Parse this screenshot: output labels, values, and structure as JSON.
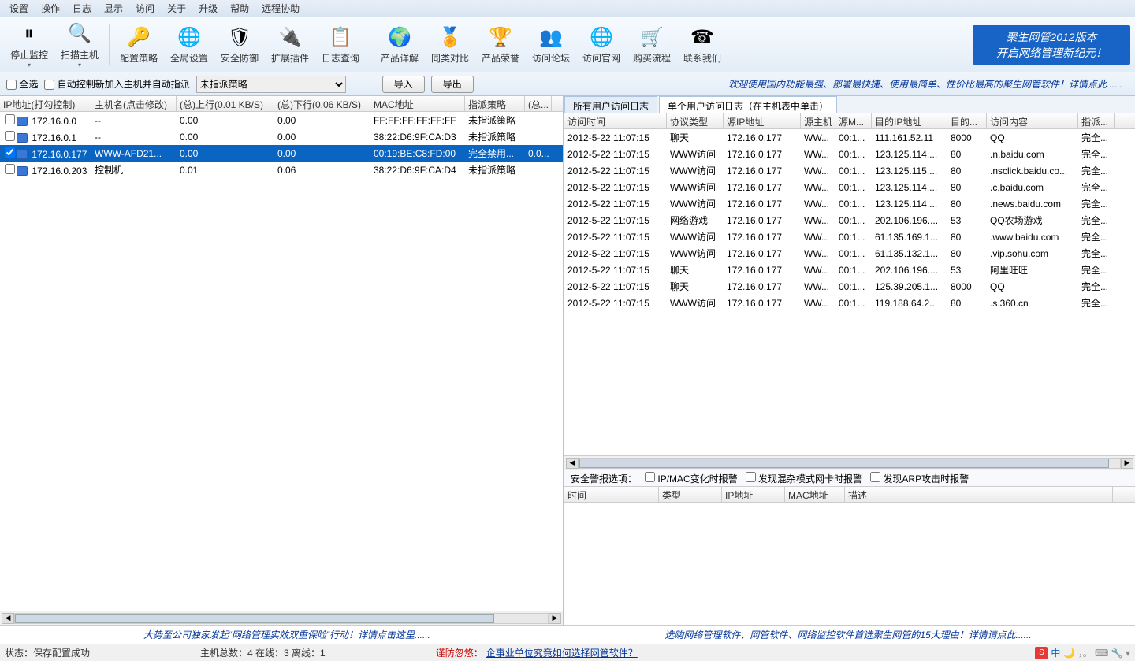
{
  "menu": [
    "设置",
    "操作",
    "日志",
    "显示",
    "访问",
    "关于",
    "升级",
    "帮助",
    "远程协助"
  ],
  "toolbar": {
    "items": [
      {
        "icon": "⏸",
        "label": "停止监控",
        "name": "stop-monitor-button",
        "split": true
      },
      {
        "icon": "🔍",
        "label": "扫描主机",
        "name": "scan-host-button",
        "split": true
      },
      {
        "sep": true
      },
      {
        "icon": "🔑",
        "label": "配置策略",
        "name": "config-policy-button"
      },
      {
        "icon": "🌐",
        "label": "全局设置",
        "name": "global-settings-button"
      },
      {
        "icon": "🛡",
        "label": "安全防御",
        "name": "security-defense-button"
      },
      {
        "icon": "🔌",
        "label": "扩展插件",
        "name": "plugins-button"
      },
      {
        "icon": "📋",
        "label": "日志查询",
        "name": "log-query-button"
      },
      {
        "sep": true
      },
      {
        "icon": "🌍",
        "label": "产品详解",
        "name": "product-detail-button"
      },
      {
        "icon": "🏅",
        "label": "同类对比",
        "name": "compare-button"
      },
      {
        "icon": "🏆",
        "label": "产品荣誉",
        "name": "honors-button"
      },
      {
        "icon": "👥",
        "label": "访问论坛",
        "name": "forum-button"
      },
      {
        "icon": "🌐",
        "label": "访问官网",
        "name": "website-button"
      },
      {
        "icon": "🛒",
        "label": "购买流程",
        "name": "purchase-button"
      },
      {
        "icon": "☎",
        "label": "联系我们",
        "name": "contact-button"
      }
    ]
  },
  "promo": {
    "line1": "聚生网管2012版本",
    "line2": "开启网络管理新纪元！"
  },
  "controlbar": {
    "select_all": "全选",
    "auto_control": "自动控制新加入主机并自动指派",
    "policy_dropdown": "未指派策略",
    "import": "导入",
    "export": "导出",
    "marquee": "欢迎使用国内功能最强、部署最快捷、使用最简单、性价比最高的聚生网管软件！详情点此......"
  },
  "hosts": {
    "columns": [
      "IP地址(打勾控制)",
      "主机名(点击修改)",
      "(总)上行(0.01 KB/S)",
      "(总)下行(0.06 KB/S)",
      "MAC地址",
      "指派策略",
      "(总..."
    ],
    "widths": [
      116,
      108,
      124,
      122,
      120,
      76,
      34
    ],
    "rows": [
      {
        "checked": false,
        "ip": "172.16.0.0",
        "host": "--",
        "up": "0.00",
        "down": "0.00",
        "mac": "FF:FF:FF:FF:FF:FF",
        "policy": "未指派策略",
        "selected": false
      },
      {
        "checked": false,
        "ip": "172.16.0.1",
        "host": "--",
        "up": "0.00",
        "down": "0.00",
        "mac": "38:22:D6:9F:CA:D3",
        "policy": "未指派策略",
        "selected": false
      },
      {
        "checked": true,
        "ip": "172.16.0.177",
        "host": "WWW-AFD21...",
        "up": "0.00",
        "down": "0.00",
        "mac": "00:19:BE:C8:FD:00",
        "policy": "完全禁用...",
        "extra": "0.0...",
        "selected": true
      },
      {
        "checked": false,
        "ip": "172.16.0.203",
        "host": "控制机",
        "up": "0.01",
        "down": "0.06",
        "mac": "38:22:D6:9F:CA:D4",
        "policy": "未指派策略",
        "selected": false
      }
    ]
  },
  "tabs": {
    "tab1": "所有用户访问日志",
    "tab2": "单个用户访问日志（在主机表中单击）"
  },
  "logs": {
    "columns": [
      "访问时间",
      "协议类型",
      "源IP地址",
      "源主机",
      "源M...",
      "目的IP地址",
      "目的...",
      "访问内容",
      "指派..."
    ],
    "widths": [
      130,
      72,
      98,
      44,
      46,
      96,
      50,
      116,
      46
    ],
    "rows": [
      {
        "time": "2012-5-22 11:07:15",
        "proto": "聊天",
        "sip": "172.16.0.177",
        "shost": "WW...",
        "smac": "00:1...",
        "dip": "111.161.52.11",
        "dport": "8000",
        "content": "QQ",
        "policy": "完全..."
      },
      {
        "time": "2012-5-22 11:07:15",
        "proto": "WWW访问",
        "sip": "172.16.0.177",
        "shost": "WW...",
        "smac": "00:1...",
        "dip": "123.125.114....",
        "dport": "80",
        "content": ".n.baidu.com",
        "policy": "完全..."
      },
      {
        "time": "2012-5-22 11:07:15",
        "proto": "WWW访问",
        "sip": "172.16.0.177",
        "shost": "WW...",
        "smac": "00:1...",
        "dip": "123.125.115....",
        "dport": "80",
        "content": ".nsclick.baidu.co...",
        "policy": "完全..."
      },
      {
        "time": "2012-5-22 11:07:15",
        "proto": "WWW访问",
        "sip": "172.16.0.177",
        "shost": "WW...",
        "smac": "00:1...",
        "dip": "123.125.114....",
        "dport": "80",
        "content": ".c.baidu.com",
        "policy": "完全..."
      },
      {
        "time": "2012-5-22 11:07:15",
        "proto": "WWW访问",
        "sip": "172.16.0.177",
        "shost": "WW...",
        "smac": "00:1...",
        "dip": "123.125.114....",
        "dport": "80",
        "content": ".news.baidu.com",
        "policy": "完全..."
      },
      {
        "time": "2012-5-22 11:07:15",
        "proto": "网络游戏",
        "sip": "172.16.0.177",
        "shost": "WW...",
        "smac": "00:1...",
        "dip": "202.106.196....",
        "dport": "53",
        "content": "QQ农场游戏",
        "policy": "完全..."
      },
      {
        "time": "2012-5-22 11:07:15",
        "proto": "WWW访问",
        "sip": "172.16.0.177",
        "shost": "WW...",
        "smac": "00:1...",
        "dip": "61.135.169.1...",
        "dport": "80",
        "content": ".www.baidu.com",
        "policy": "完全..."
      },
      {
        "time": "2012-5-22 11:07:15",
        "proto": "WWW访问",
        "sip": "172.16.0.177",
        "shost": "WW...",
        "smac": "00:1...",
        "dip": "61.135.132.1...",
        "dport": "80",
        "content": ".vip.sohu.com",
        "policy": "完全..."
      },
      {
        "time": "2012-5-22 11:07:15",
        "proto": "聊天",
        "sip": "172.16.0.177",
        "shost": "WW...",
        "smac": "00:1...",
        "dip": "202.106.196....",
        "dport": "53",
        "content": "阿里旺旺",
        "policy": "完全..."
      },
      {
        "time": "2012-5-22 11:07:15",
        "proto": "聊天",
        "sip": "172.16.0.177",
        "shost": "WW...",
        "smac": "00:1...",
        "dip": "125.39.205.1...",
        "dport": "8000",
        "content": "QQ",
        "policy": "完全..."
      },
      {
        "time": "2012-5-22 11:07:15",
        "proto": "WWW访问",
        "sip": "172.16.0.177",
        "shost": "WW...",
        "smac": "00:1...",
        "dip": "119.188.64.2...",
        "dport": "80",
        "content": ".s.360.cn",
        "policy": "完全..."
      }
    ]
  },
  "alert": {
    "label": "安全警报选项：",
    "opt1": "IP/MAC变化时报警",
    "opt2": "发现混杂模式网卡时报警",
    "opt3": "发现ARP攻击时报警",
    "columns": [
      "时间",
      "类型",
      "IP地址",
      "MAC地址",
      "描述"
    ],
    "widths": [
      120,
      80,
      80,
      76,
      340
    ]
  },
  "footer": {
    "left": "大势至公司独家发起“网络管理实效双重保险”行动！详情点击这里......",
    "right": "选购网络管理软件、网管软件、网络监控软件首选聚生网管的15大理由！详情请点此......"
  },
  "statusbar": {
    "status": "状态：保存配置成功",
    "hostcount": "主机总数：4  在线：3  离线：1",
    "tip_label": "谨防忽悠：",
    "tip_link": "企事业单位究竟如何选择网管软件？",
    "ime": "中"
  }
}
